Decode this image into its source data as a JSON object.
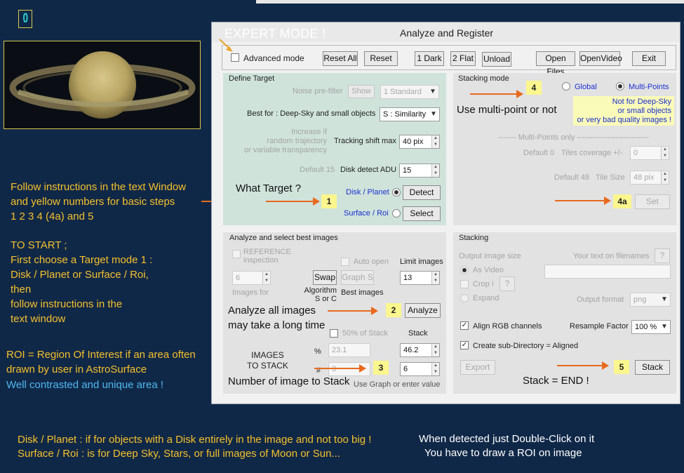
{
  "logo": {
    "glyph": "0"
  },
  "left_notes": {
    "instructions": [
      "Follow instructions in the text Window",
      "and yellow numbers for basic steps",
      "1  2  3  4  (4a) and 5"
    ],
    "to_start": [
      "TO START ;",
      "First choose a Target mode 1 :",
      "Disk / Planet or Surface / Roi,",
      "then",
      "follow instructions in the",
      "text window"
    ],
    "roi": [
      "ROI  = Region Of Interest if an area often",
      "drawn by user in AstroSurface"
    ],
    "roi_tip": "Well contrasted and unique area !"
  },
  "bottom_notes": {
    "disk": "Disk / Planet :    if for objects with a Disk entirely in the image and not too big !",
    "surface": "Surface / Roi :   is for Deep Sky, Stars, or full images of Moon or Sun...",
    "detected": "When detected just Double-Click on it",
    "draw_roi": "You have to draw a ROI on image"
  },
  "window": {
    "title": "Analyze and Register",
    "expert_mode": "EXPERT MODE !",
    "toolbar": {
      "advanced_mode": "Advanced mode",
      "reset_all": "Reset All",
      "reset": "Reset",
      "one_dark": "1 Dark",
      "two_flat": "2 Flat",
      "unload": "Unload",
      "open_files": "Open Files",
      "open_video": "OpenVideo",
      "exit": "Exit"
    },
    "define_target": {
      "title": "Define Target",
      "noise_prefilter": "Noise pre-filter",
      "show": "Show",
      "filter_value": "1 Standard",
      "best_for": "Best for : Deep-Sky and small objects",
      "similarity": "S : Similarity",
      "increase_if": [
        "Increase if",
        "random trajectory",
        "or variable transparency"
      ],
      "tracking_shift": "Tracking shift max",
      "tracking_value": "40 pix",
      "default_15": "Default 15",
      "disk_detect": "Disk detect ADU",
      "disk_detect_value": "15",
      "what_target": "What Target ?",
      "step1": "1",
      "disk_planet": "Disk / Planet",
      "detect": "Detect",
      "surface_roi": "Surface / Roi",
      "select": "Select"
    },
    "stacking_mode": {
      "title": "Stacking mode",
      "step4": "4",
      "global": "Global",
      "multi_points": "Multi-Points",
      "use_multi": "Use multi-point or not",
      "not_for": [
        "Not for Deep-Sky",
        "or small objects",
        "or very bad quality images !"
      ],
      "multi_only": "------- Multi-Points only ----------------------------",
      "default_0": "Default 0",
      "tiles_coverage": "Tiles coverage +/-",
      "tiles_coverage_value": "0",
      "default_48": "Default 48",
      "tile_size": "Tile Size",
      "tile_size_value": "48 pix",
      "step4a": "4a",
      "set": "Set"
    },
    "analyze": {
      "title": "Analyze and select best images",
      "reference": [
        "REFERENCE",
        "inspection"
      ],
      "auto_open": "Auto open",
      "limit_images": "Limit images",
      "ref_value": "6",
      "swap": "Swap",
      "graph_s": "Graph S",
      "limit_value": "13",
      "images_for": "Images for",
      "algorithm": [
        "Algorithm",
        "S or C"
      ],
      "best_images": "Best images",
      "analyze_all": [
        "Analyze all images",
        "may take a long time"
      ],
      "step2": "2",
      "analyze_btn": "Analyze",
      "percent_of_stack": "50% of Stack",
      "stack_label": "Stack",
      "images_to_stack": [
        "IMAGES",
        "TO STACK"
      ],
      "pct_sign": "%",
      "hash_sign": "#",
      "pct_value": "23.1",
      "stack_pct_value": "46.2",
      "num_value": "3",
      "step3": "3",
      "stack_num_value": "6",
      "number_to_stack": "Number of image to Stack",
      "use_graph": "Use Graph or enter value"
    },
    "stacking": {
      "title": "Stacking",
      "output_size": "Output image size",
      "text_on_filenames": "Your text on filenames",
      "q": "?",
      "as_video": "As Video",
      "crop": "Crop !",
      "expand": "Expand",
      "output_format": "Output format",
      "format_value": "png",
      "align_rgb": "Align RGB channels",
      "resample": "Resample Factor",
      "resample_value": "100 %",
      "create_subdir": "Create sub-Directory = Aligned",
      "export": "Export",
      "step5": "5",
      "stack_btn": "Stack",
      "stack_end": "Stack = END !"
    }
  },
  "colors": {
    "background": "#102848",
    "note_yellow": "#f5c02a",
    "note_blue": "#4fb8f0",
    "arrow": "#e86a1e",
    "step_box": "#fbf68e",
    "target_panel": "#cfe3da"
  }
}
